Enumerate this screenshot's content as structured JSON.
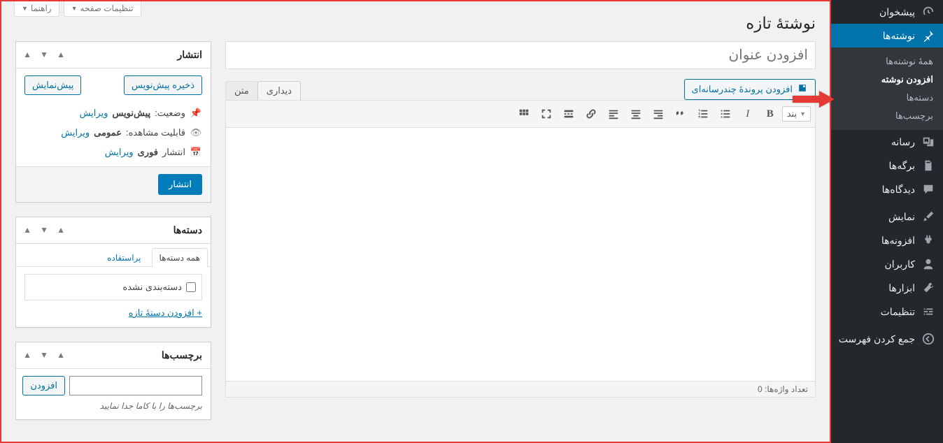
{
  "menu": {
    "dashboard": "پیشخوان",
    "posts": "نوشته‌ها",
    "posts_sub": {
      "all": "همهٔ نوشته‌ها",
      "new": "افزودن نوشته",
      "cats": "دسته‌ها",
      "tags": "برچسب‌ها"
    },
    "media": "رسانه",
    "pages": "برگه‌ها",
    "comments": "دیدگاه‌ها",
    "appearance": "نمایش",
    "plugins": "افزونه‌ها",
    "users": "کاربران",
    "tools": "ابزارها",
    "settings": "تنظیمات",
    "collapse": "جمع کردن فهرست"
  },
  "screen_meta": {
    "options": "تنظیمات صفحه",
    "help": "راهنما"
  },
  "page_title": "نوشتهٔ تازه",
  "title_placeholder": "افزودن عنوان",
  "add_media": "افزودن پروندهٔ چندرسانه‌ای",
  "tabs": {
    "visual": "دیداری",
    "text": "متن"
  },
  "toolbar": {
    "format_label": "بند"
  },
  "word_count_label": "تعداد واژه‌ها:",
  "word_count": "0",
  "publish": {
    "title": "انتشار",
    "save_draft": "ذخیره پیش‌نویس",
    "preview": "پیش‌نمایش",
    "status_label": "وضعیت:",
    "status_value": "پیش‌نویس",
    "visibility_label": "قابلیت مشاهده:",
    "visibility_value": "عمومی",
    "schedule_label": "انتشار",
    "schedule_value": "فوری",
    "edit": "ویرایش",
    "publish_btn": "انتشار"
  },
  "categories": {
    "title": "دسته‌ها",
    "tab_all": "همه دسته‌ها",
    "tab_used": "پراستفاده",
    "uncat": "دسته‌بندی نشده",
    "add_new": "+ افزودن دستهٔ تازه"
  },
  "tags": {
    "title": "برچسب‌ها",
    "add_btn": "افزودن",
    "hint": "برچسب‌ها را با کاما جدا نمایید"
  }
}
